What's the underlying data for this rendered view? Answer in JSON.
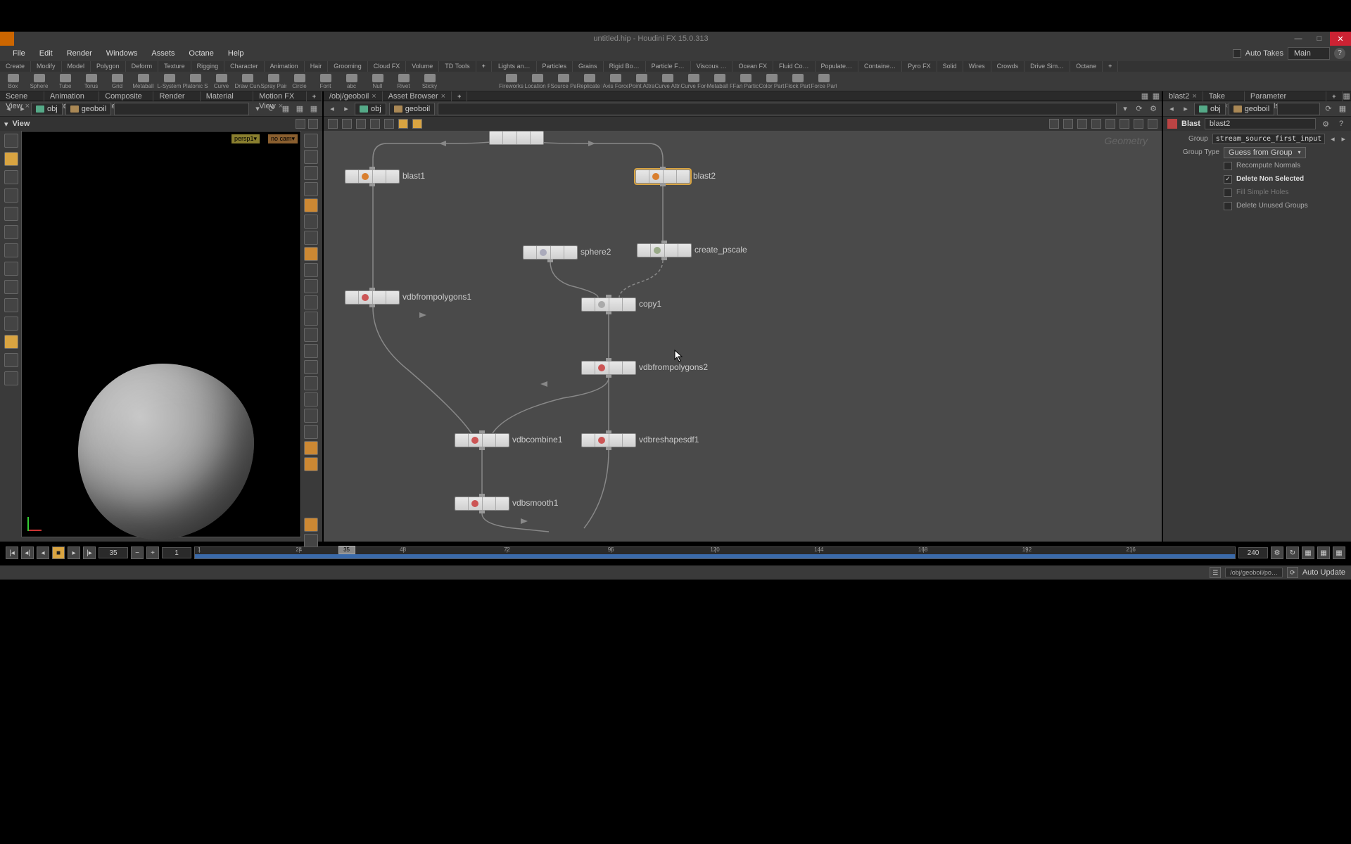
{
  "title": "untitled.hip - Houdini FX 15.0.313",
  "menus": [
    "File",
    "Edit",
    "Render",
    "Windows",
    "Assets",
    "Octane",
    "Help"
  ],
  "menubar_right": {
    "autotakes": "Auto Takes",
    "take": "Main"
  },
  "shelf_tabs_left": [
    "Create",
    "Modify",
    "Model",
    "Polygon",
    "Deform",
    "Texture",
    "Rigging",
    "Character",
    "Animation",
    "Hair",
    "Grooming",
    "Cloud FX",
    "Volume",
    "TD Tools",
    "+"
  ],
  "shelf_tabs_right": [
    "Lights an…",
    "Particles",
    "Grains",
    "Rigid Bo…",
    "Particle F…",
    "Viscous …",
    "Ocean FX",
    "Fluid Co…",
    "Populate…",
    "Containe…",
    "Pyro FX",
    "Solid",
    "Wires",
    "Crowds",
    "Drive Sim…",
    "Octane",
    "+"
  ],
  "shelf_tools_left": [
    {
      "label": "Box"
    },
    {
      "label": "Sphere"
    },
    {
      "label": "Tube"
    },
    {
      "label": "Torus"
    },
    {
      "label": "Grid"
    },
    {
      "label": "Metaball"
    },
    {
      "label": "L-System"
    },
    {
      "label": "Platonic Sol…"
    },
    {
      "label": "Curve"
    },
    {
      "label": "Draw Curve"
    },
    {
      "label": "Spray Paint"
    },
    {
      "label": "Circle"
    },
    {
      "label": "Font"
    },
    {
      "label": "abc"
    },
    {
      "label": "Null"
    },
    {
      "label": "Rivet"
    },
    {
      "label": "Sticky"
    }
  ],
  "shelf_tools_right": [
    {
      "label": "Fireworks"
    },
    {
      "label": "Location Pa…"
    },
    {
      "label": "Source Parti…"
    },
    {
      "label": "Replicate P…"
    },
    {
      "label": "Axis Force"
    },
    {
      "label": "Point Attrac…"
    },
    {
      "label": "Curve Attra…"
    },
    {
      "label": "Curve Force…"
    },
    {
      "label": "Metaball Fo…"
    },
    {
      "label": "Fan Particles"
    },
    {
      "label": "Color Partic…"
    },
    {
      "label": "Flock Particl…"
    },
    {
      "label": "Force Particl…"
    }
  ],
  "pane_tabs_left": [
    "Scene View",
    "Animation Editor",
    "Composite View",
    "Render View",
    "Material Palette",
    "Motion FX View",
    "+"
  ],
  "pane_tabs_center": [
    "/obj/geoboil",
    "Asset Browser",
    "+"
  ],
  "pane_tabs_right": [
    "blast2",
    "Take List",
    "Parameter Spreadsheet",
    "+"
  ],
  "path_obj": "obj",
  "path_geo": "geoboil",
  "viewport": {
    "header": "View",
    "badge_persp": "persp1▾",
    "badge_cam": "no cam▾"
  },
  "network": {
    "corner_label": "Geometry",
    "nodes": {
      "blast1": "blast1",
      "blast2": "blast2",
      "sphere2": "sphere2",
      "create_pscale": "create_pscale",
      "vdbfrompolygons1": "vdbfrompolygons1",
      "copy1": "copy1",
      "vdbfrompolygons2": "vdbfrompolygons2",
      "vdbcombine1": "vdbcombine1",
      "vdbreshapesdf1": "vdbreshapesdf1",
      "vdbsmooth1": "vdbsmooth1"
    }
  },
  "params": {
    "op_type": "Blast",
    "op_name": "blast2",
    "group_label": "Group",
    "group_value": "stream_source_first_input",
    "grouptype_label": "Group Type",
    "grouptype_value": "Guess from Group",
    "recompute_normals": "Recompute Normals",
    "delete_non_selected": "Delete Non Selected",
    "fill_simple_holes": "Fill Simple Holes",
    "delete_unused_groups": "Delete Unused Groups"
  },
  "timeline": {
    "current": "35",
    "start": "1",
    "end": "240",
    "ticks": [
      "1",
      "24",
      "48",
      "72",
      "96",
      "120",
      "144",
      "168",
      "192",
      "216"
    ]
  },
  "status": {
    "path": "/obj/geoboil/po…",
    "auto_update": "Auto Update"
  }
}
